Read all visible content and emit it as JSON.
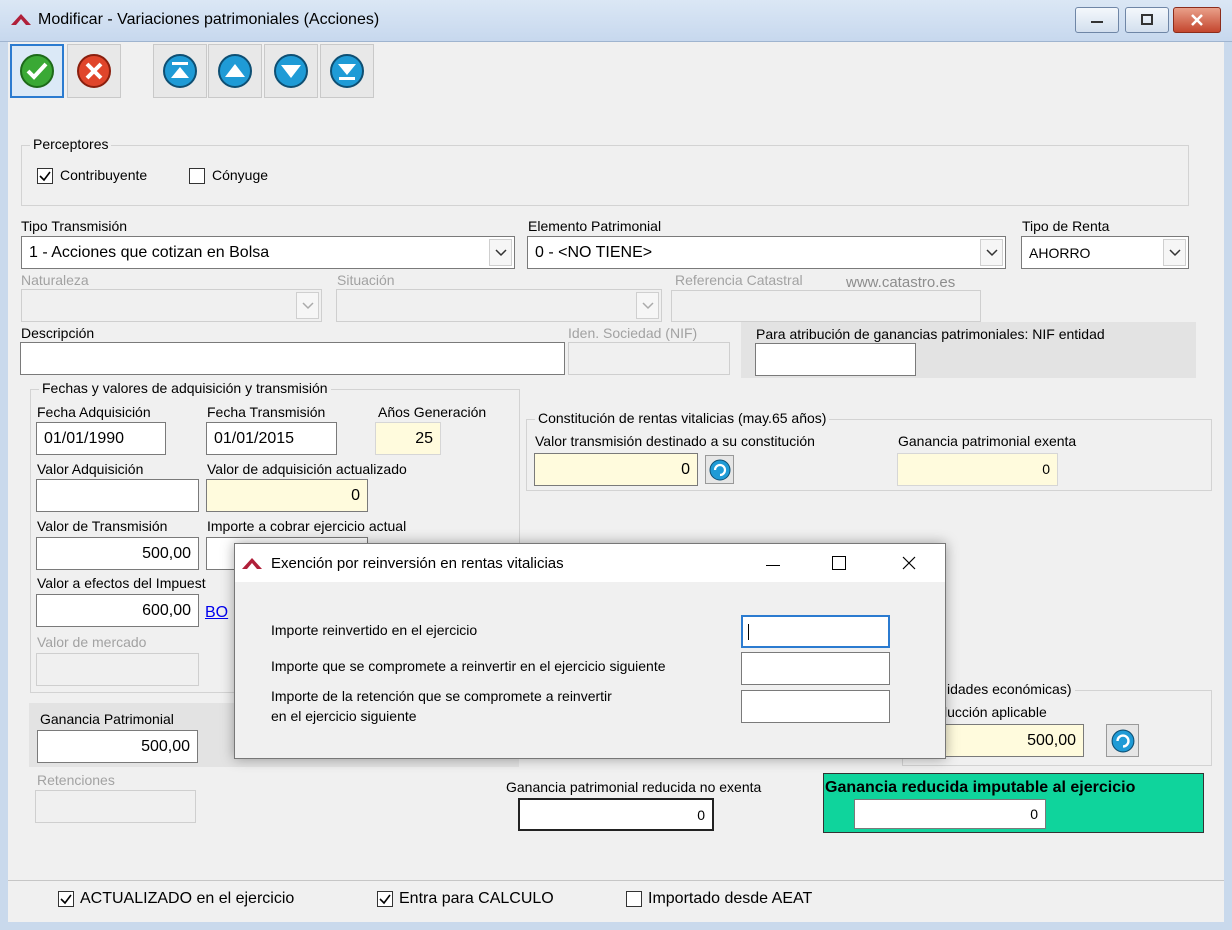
{
  "window": {
    "title": "Modificar - Variaciones patrimoniales (Acciones)"
  },
  "perceptores": {
    "legend": "Perceptores",
    "contribuyente_label": "Contribuyente",
    "contribuyente_checked": true,
    "conyuge_label": "Cónyuge",
    "conyuge_checked": false
  },
  "tipo_transmision": {
    "label": "Tipo Transmisión",
    "value": "1 - Acciones que cotizan en Bolsa"
  },
  "elemento_patrimonial": {
    "label": "Elemento Patrimonial",
    "value": "0 - <NO TIENE>"
  },
  "tipo_renta": {
    "label": "Tipo de Renta",
    "value": "AHORRO"
  },
  "naturaleza": {
    "label": "Naturaleza",
    "value": ""
  },
  "situacion": {
    "label": "Situación",
    "value": ""
  },
  "referencia_catastral": {
    "label": "Referencia Catastral",
    "link": "www.catastro.es",
    "value": ""
  },
  "descripcion": {
    "label": "Descripción",
    "value": ""
  },
  "iden_sociedad": {
    "label": "Iden. Sociedad (NIF)",
    "value": ""
  },
  "atribucion": {
    "label": "Para atribución de ganancias patrimoniales: NIF entidad",
    "value": ""
  },
  "fechas": {
    "legend": "Fechas y valores de adquisición y transmisión",
    "fecha_adquisicion_label": "Fecha Adquisición",
    "fecha_adquisicion": "01/01/1990",
    "fecha_transmision_label": "Fecha Transmisión",
    "fecha_transmision": "01/01/2015",
    "anos_generacion_label": "Años Generación",
    "anos_generacion": "25",
    "valor_adquisicion_label": "Valor Adquisición",
    "valor_adquisicion": "",
    "valor_adq_actualizado_label": "Valor de adquisición actualizado",
    "valor_adq_actualizado": "0",
    "valor_transmision_label": "Valor de Transmisión",
    "valor_transmision": "500,00",
    "importe_cobrar_label": "Importe a cobrar ejercicio actual",
    "importe_cobrar": "",
    "valor_efectos_label": "Valor a efectos del Impuest",
    "valor_efectos": "600,00",
    "boe_link": "BO",
    "valor_mercado_label": "Valor de mercado",
    "valor_mercado": ""
  },
  "rentas_vitalicias": {
    "legend": "Constitución de rentas vitalicias (may.65 años)",
    "valor_destinado_label": "Valor transmisión destinado a su constitución",
    "valor_destinado": "0",
    "ganancia_exenta_label": "Ganancia patrimonial exenta",
    "ganancia_exenta": "0"
  },
  "actividades": {
    "legend_partial": "idades económicas)",
    "reduccion_label_partial": "lucción aplicable",
    "reduccion_value": "500,00"
  },
  "ganancia_patrimonial": {
    "label": "Ganancia Patrimonial",
    "value": "500,00"
  },
  "retenciones": {
    "label": "Retenciones",
    "value": ""
  },
  "ganancia_reducida_no_exenta": {
    "label": "Ganancia patrimonial reducida no exenta",
    "value": "0"
  },
  "ganancia_imputable": {
    "label": "Ganancia reducida imputable al ejercicio",
    "value": "0"
  },
  "footer": {
    "actualizado_label": "ACTUALIZADO en el ejercicio",
    "actualizado_checked": true,
    "calculo_label": "Entra para CALCULO",
    "calculo_checked": true,
    "importado_label": "Importado desde AEAT",
    "importado_checked": false
  },
  "dialog": {
    "title": "Exención por reinversión en rentas vitalicias",
    "importe_reinvertido_label": "Importe reinvertido en el ejercicio",
    "importe_reinvertido": "",
    "importe_compromete_label": "Importe que se compromete a reinvertir en el ejercicio siguiente",
    "importe_compromete": "",
    "retencion_label_1": "Importe de la retención que se compromete a reinvertir",
    "retencion_label_2": "en el ejercicio siguiente",
    "retencion": ""
  },
  "colors": {
    "titlebar": "#c7d8ee",
    "green_panel": "#0fd49c",
    "yellow_field": "#fffbdd",
    "accept": "#3aa935",
    "cancel": "#e0452b",
    "nav": "#1f9bd6"
  }
}
